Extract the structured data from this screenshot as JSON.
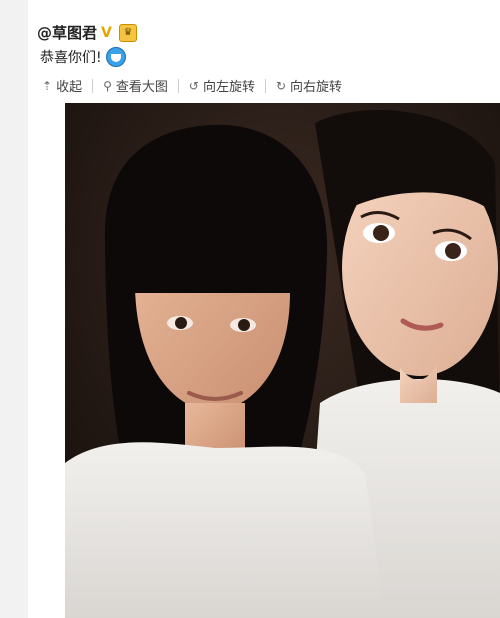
{
  "post": {
    "username": "@草图君",
    "verified_icon": "verified-v-icon",
    "badge_icon": "member-badge-icon",
    "text": "恭喜你们!",
    "emoji_icon": "doraemon-emoji-icon"
  },
  "toolbar": {
    "collapse_label": "收起",
    "view_large_label": "查看大图",
    "rotate_left_label": "向左旋转",
    "rotate_right_label": "向右旋转"
  },
  "photo": {
    "description_icon": "selfie-photo"
  }
}
